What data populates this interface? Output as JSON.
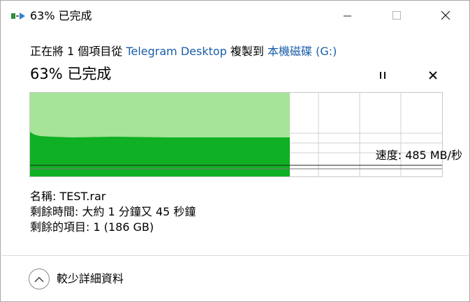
{
  "window": {
    "title": "63% 已完成",
    "minimize_icon": "minimize-icon",
    "maximize_icon": "maximize-icon",
    "close_icon": "close-icon"
  },
  "header": {
    "prefix": "正在將 1 個項目從 ",
    "source": "Telegram Desktop",
    "middle": " 複製到 ",
    "destination": "本機磁碟 (G:)",
    "progress_text": "63% 已完成"
  },
  "controls": {
    "pause_icon": "pause-icon",
    "cancel_icon": "cancel-icon"
  },
  "graph": {
    "progress_percent": 63,
    "speed_text": "速度: 485 MB/秒",
    "colors": {
      "fill_light": "#a6e499",
      "fill_dark": "#0fb023",
      "grid": "#d0d0d0"
    }
  },
  "details": {
    "name_label": "名稱:",
    "name_value": "TEST.rar",
    "time_label": "剩餘時間:",
    "time_value": "大約 1 分鐘又 45 秒鐘",
    "items_label": "剩餘的項目:",
    "items_value": "1 (186 GB)"
  },
  "footer": {
    "more_icon": "chevron-up-icon",
    "more_label": "較少詳細資料"
  }
}
